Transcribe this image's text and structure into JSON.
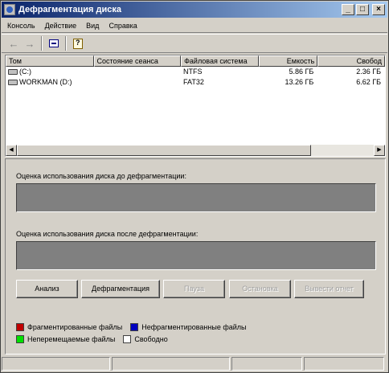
{
  "window": {
    "title": "Дефрагментация диска"
  },
  "title_buttons": {
    "minimize": "_",
    "maximize": "□",
    "close": "×"
  },
  "menu": [
    "Консоль",
    "Действие",
    "Вид",
    "Справка"
  ],
  "toolbar": {
    "back": "←",
    "forward": "→"
  },
  "list": {
    "columns": [
      "Том",
      "Состояние сеанса",
      "Файловая система",
      "Емкость",
      "Свобод"
    ],
    "rows": [
      {
        "volume": "(C:)",
        "status": "",
        "fs": "NTFS",
        "capacity": "5.86 ГБ",
        "free": "2.36 ГБ"
      },
      {
        "volume": "WORKMAN (D:)",
        "status": "",
        "fs": "FAT32",
        "capacity": "13.26 ГБ",
        "free": "6.62 ГБ"
      }
    ]
  },
  "scroll": {
    "left": "◀",
    "right": "▶"
  },
  "analysis": {
    "before_label": "Оценка использования диска до дефрагментации:",
    "after_label": "Оценка использования диска после дефрагментации:"
  },
  "buttons": {
    "analyze": "Анализ",
    "defragment": "Дефрагментация",
    "pause": "Пауза",
    "stop": "Остановка",
    "report": "Вывести отчет"
  },
  "legend": {
    "fragmented": "Фрагментированные файлы",
    "contiguous": "Нефрагментированные файлы",
    "unmovable": "Неперемещаемые файлы",
    "free": "Свободно"
  },
  "colors": {
    "fragmented": "#c00000",
    "contiguous": "#0000c0",
    "unmovable": "#00e000",
    "free": "#ffffff",
    "titlebar": "#0a246a"
  }
}
